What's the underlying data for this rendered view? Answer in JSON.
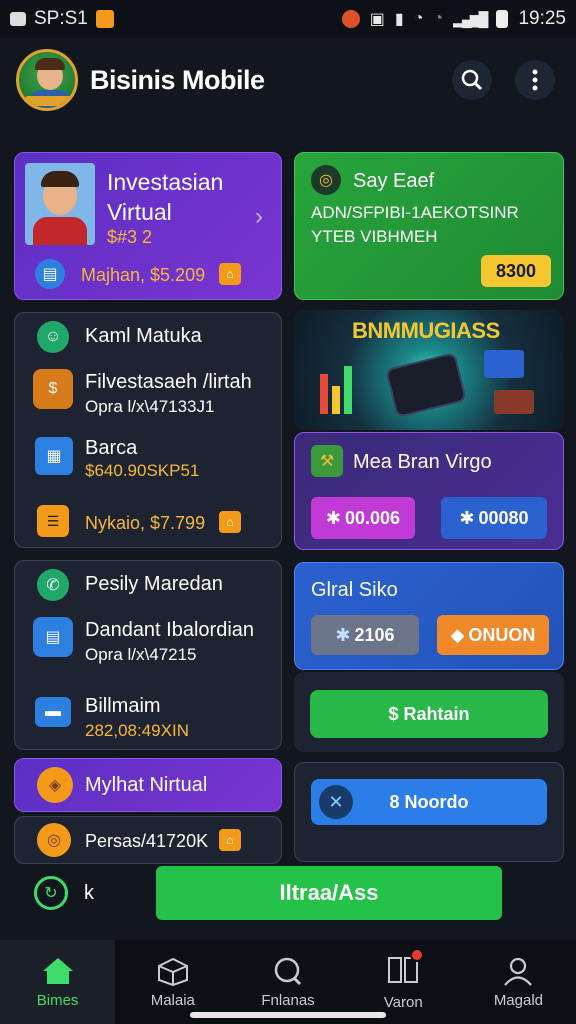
{
  "status_bar": {
    "left_time": "SP:S1",
    "right_time": "19:25"
  },
  "header": {
    "app_title": "Bisinis Mobile"
  },
  "cards": {
    "invest": {
      "title_line1": "Investasian",
      "title_line2": "Virtual",
      "sub": "$#3 2",
      "footer": "Majhan, $5.209"
    },
    "say_easy": {
      "title": "Say Eaef",
      "line1": "ADN/SFPIBI-1AEKOTSINR",
      "line2": "YTEB VIBHMEH",
      "button": "8300"
    },
    "left_list": {
      "header": "Kaml Matuka",
      "item1_title": "Filvestasaeh /lirtah",
      "item1_sub": "Opra l/x\\47133J1",
      "item2_title": "Barca",
      "item2_sub": "$640.90SKP51",
      "footer": "Nykaio, $7.799"
    },
    "banner": {
      "title": "BNMMUGIASS"
    },
    "mea_bran": {
      "title": "Mea Bran Virgo",
      "btn1": "00.006",
      "btn2": "00080"
    },
    "left_list2": {
      "header": "Pesily Maredan",
      "item1_title": "Dandant Ibalordian",
      "item1_sub": "Opra l/x\\47215",
      "item2_title": "Billmaim",
      "item2_sub": "282,08:49XIN"
    },
    "global": {
      "title": "Glral Siko",
      "btn1": "2106",
      "btn2": "ONUON",
      "action": "$ Rahtain"
    },
    "mylhat": {
      "title": "Mylhat Nirtual"
    },
    "noordo": {
      "button": "8 Noordo"
    },
    "persas": {
      "text": "Persas/41720K"
    },
    "bottom_btn": {
      "label": "Iltraa/Ass",
      "left_text": "k"
    }
  },
  "nav": {
    "items": [
      {
        "label": "Bimes"
      },
      {
        "label": "Malaia"
      },
      {
        "label": "Fnlanas"
      },
      {
        "label": "Varon"
      },
      {
        "label": "Magald"
      }
    ]
  },
  "colors": {
    "accent_green": "#3ddc6a",
    "accent_orange": "#f6b83a",
    "purple": "#6a31cc",
    "blue": "#2b62d0"
  }
}
